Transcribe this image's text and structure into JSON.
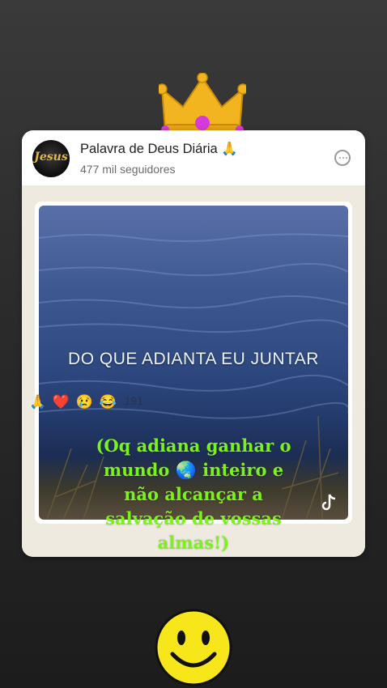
{
  "post": {
    "channel_name": "Palavra de Deus Diária 🙏",
    "followers": "477 mil seguidores",
    "avatar_text": "Jesus",
    "video_overlay_text": "DO QUE ADIANTA EU JUNTAR",
    "reactions": [
      "🙏",
      "❤️",
      "😢",
      "😂"
    ],
    "reaction_count": "191"
  },
  "caption": {
    "line1": "(Oq adiana ganhar o",
    "line2": "mundo 🌏 inteiro e",
    "line3": "não alcançar a",
    "line4": "salvação de vossas",
    "line5": "almas!)"
  },
  "stickers": {
    "top": "crown-sticker",
    "bottom": "smiley-sticker"
  },
  "colors": {
    "caption_text": "#7cf21b",
    "card_background": "#f3f1ea",
    "page_background": "#2b2b2b"
  }
}
